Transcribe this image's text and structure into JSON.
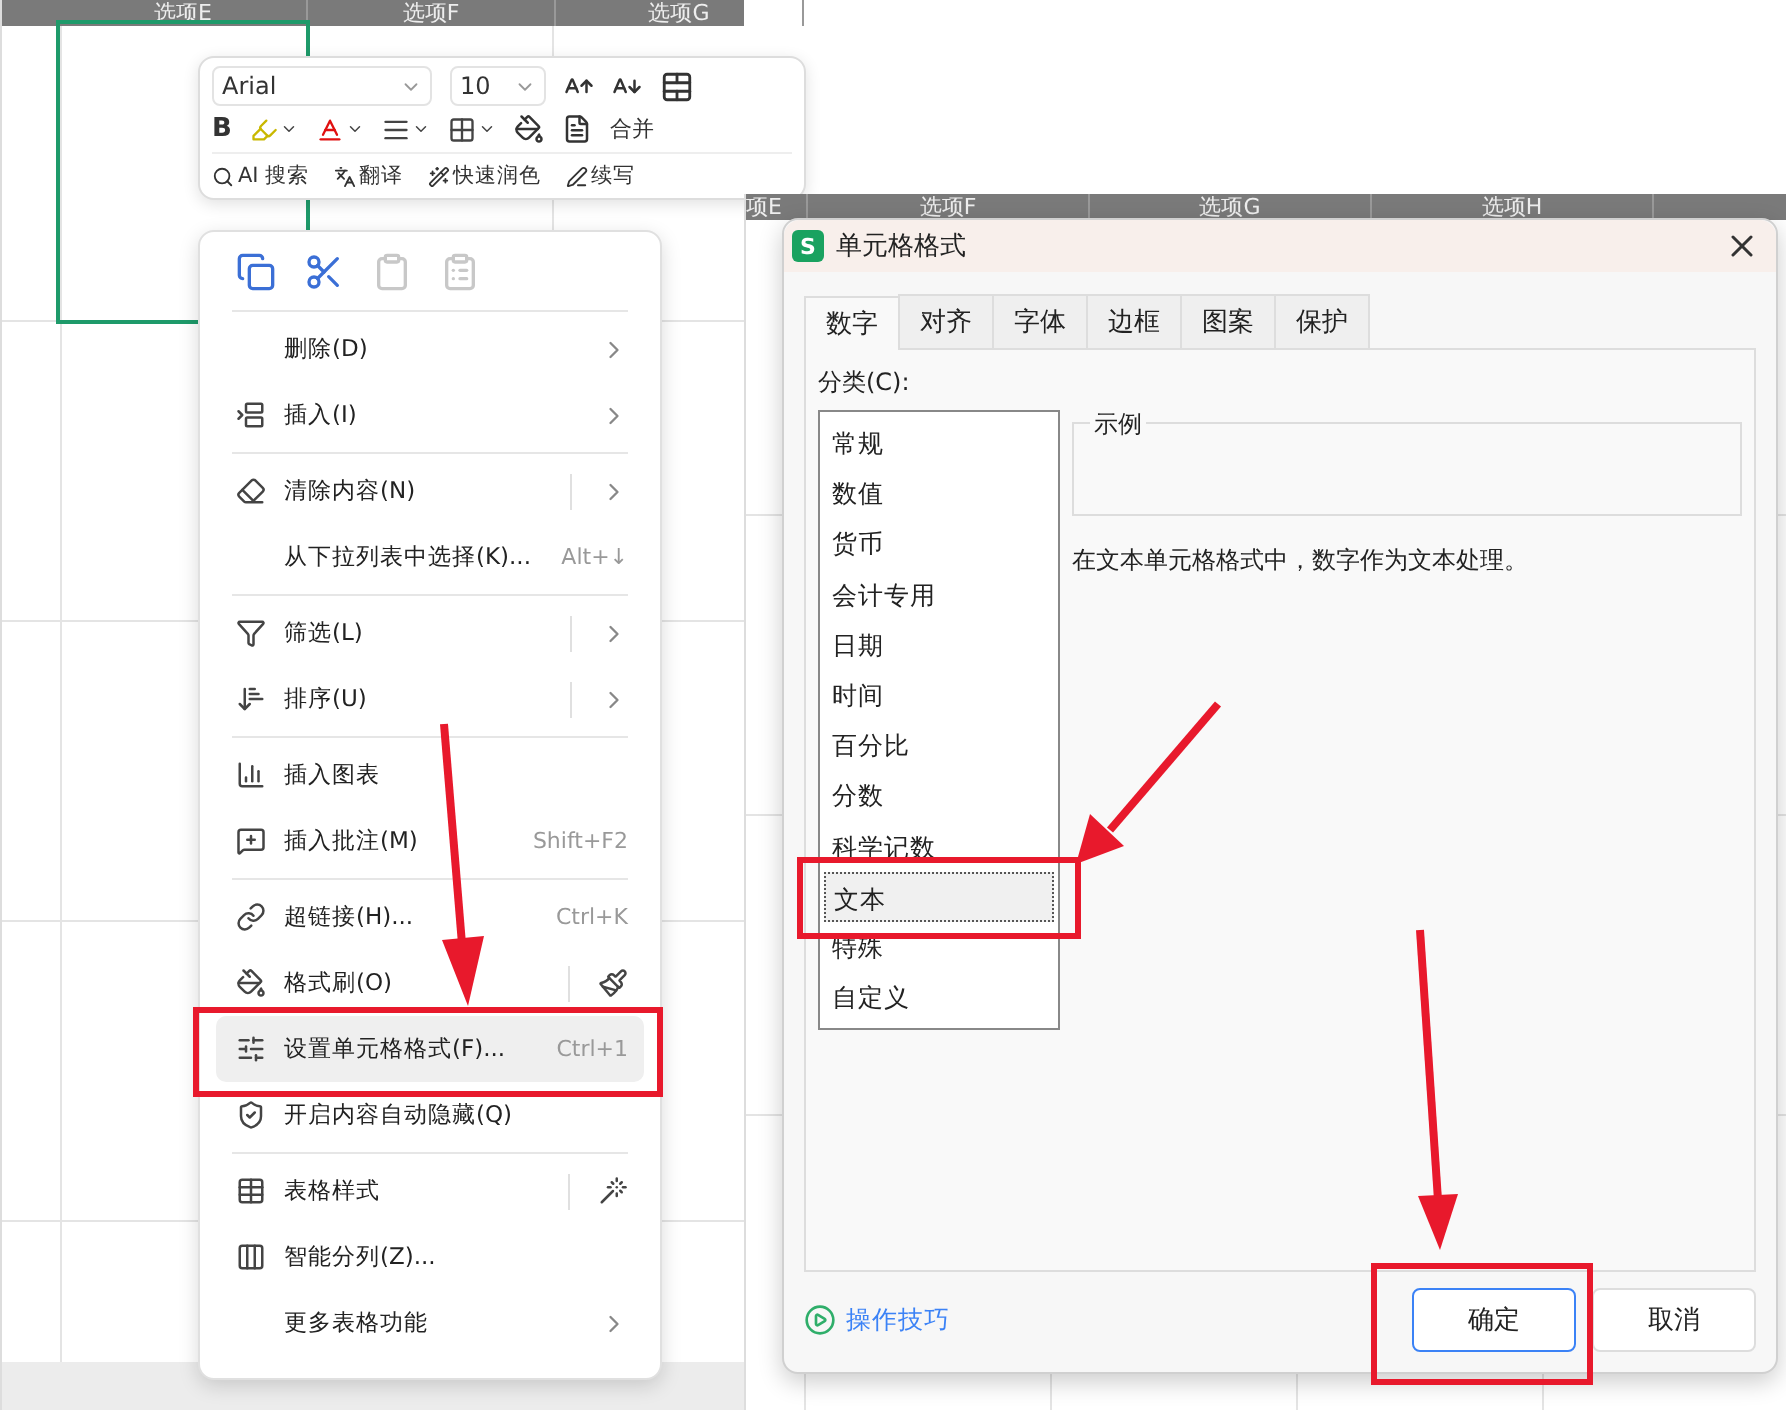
{
  "left_sheet": {
    "columns": [
      "选项E",
      "选项F",
      "选项G"
    ]
  },
  "mini_toolbar": {
    "font": "Arial",
    "size": "10",
    "bold": "B",
    "merge": "合并",
    "ai_tools": [
      {
        "label": "AI 搜索"
      },
      {
        "label": "翻译"
      },
      {
        "label": "快速润色"
      },
      {
        "label": "续写"
      }
    ]
  },
  "context_menu": {
    "clipboard": [
      {
        "disabled": false
      },
      {
        "disabled": false
      },
      {
        "disabled": true
      },
      {
        "disabled": true
      }
    ],
    "groups": [
      [
        {
          "label": "删除(D)",
          "submenu": true,
          "split": false,
          "selected": false
        },
        {
          "label": "插入(I)",
          "submenu": true,
          "split": false,
          "selected": false
        }
      ],
      [
        {
          "label": "清除内容(N)",
          "submenu": true,
          "split": true,
          "selected": false
        },
        {
          "label": "从下拉列表中选择(K)...",
          "shortcut": "Alt+↓",
          "submenu": false,
          "split": false,
          "selected": false
        }
      ],
      [
        {
          "label": "筛选(L)",
          "submenu": true,
          "split": true,
          "selected": false
        },
        {
          "label": "排序(U)",
          "submenu": true,
          "split": true,
          "selected": false
        }
      ],
      [
        {
          "label": "插入图表",
          "submenu": false,
          "split": false,
          "selected": false
        },
        {
          "label": "插入批注(M)",
          "shortcut": "Shift+F2",
          "submenu": false,
          "split": false,
          "selected": false
        }
      ],
      [
        {
          "label": "超链接(H)...",
          "shortcut": "Ctrl+K",
          "submenu": false,
          "split": false,
          "selected": false
        },
        {
          "label": "格式刷(O)",
          "submenu": false,
          "split": true,
          "selected": false
        },
        {
          "label": "设置单元格格式(F)...",
          "shortcut": "Ctrl+1",
          "submenu": false,
          "split": false,
          "selected": true
        },
        {
          "label": "开启内容自动隐藏(Q)",
          "submenu": false,
          "split": false,
          "selected": false
        }
      ],
      [
        {
          "label": "表格样式",
          "submenu": false,
          "split": true,
          "selected": false
        },
        {
          "label": "智能分列(Z)...",
          "submenu": false,
          "split": false,
          "selected": false
        },
        {
          "label": "更多表格功能",
          "submenu": true,
          "split": false,
          "selected": false
        }
      ]
    ]
  },
  "right_sheet": {
    "columns": [
      "项E",
      "选项F",
      "选项G",
      "选项H"
    ]
  },
  "dialog": {
    "logo": "S",
    "title": "单元格格式",
    "tabs": [
      {
        "label": "数字",
        "selected": true
      },
      {
        "label": "对齐",
        "selected": false
      },
      {
        "label": "字体",
        "selected": false
      },
      {
        "label": "边框",
        "selected": false
      },
      {
        "label": "图案",
        "selected": false
      },
      {
        "label": "保护",
        "selected": false
      }
    ],
    "category_label": "分类(C):",
    "categories": [
      {
        "label": "常规",
        "selected": false
      },
      {
        "label": "数值",
        "selected": false
      },
      {
        "label": "货币",
        "selected": false
      },
      {
        "label": "会计专用",
        "selected": false
      },
      {
        "label": "日期",
        "selected": false
      },
      {
        "label": "时间",
        "selected": false
      },
      {
        "label": "百分比",
        "selected": false
      },
      {
        "label": "分数",
        "selected": false
      },
      {
        "label": "科学记数",
        "selected": false
      },
      {
        "label": "文本",
        "selected": true
      },
      {
        "label": "特殊",
        "selected": false
      },
      {
        "label": "自定义",
        "selected": false
      }
    ],
    "sample_label": "示例",
    "description": "在文本单元格格式中，数字作为文本处理。",
    "tips_link": "操作技巧",
    "buttons": [
      {
        "label": "确定",
        "kind": "primary"
      },
      {
        "label": "取消",
        "kind": "secondary"
      }
    ]
  }
}
